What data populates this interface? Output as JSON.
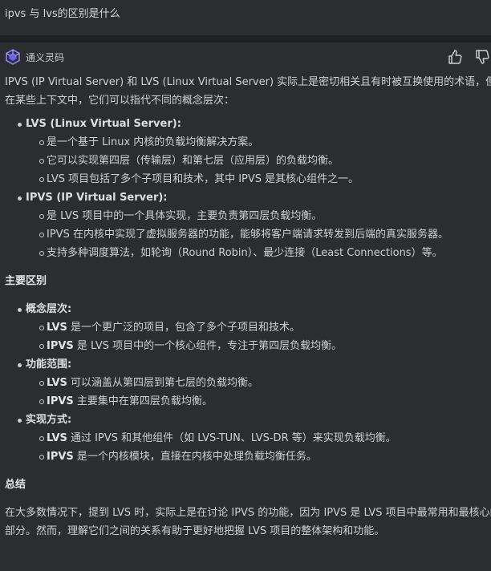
{
  "question": "ipvs 与 lvs的区别是什么",
  "assistant": {
    "name": "通义灵码",
    "logo_icon": "tongyi-logo-icon",
    "accent": "#7a6bff"
  },
  "actions": {
    "like_icon": "thumbs-up-icon",
    "dislike_icon": "thumbs-down-icon"
  },
  "answer": {
    "intro": "IPVS (IP Virtual Server) 和 LVS (Linux Virtual Server) 实际上是密切相关且有时被互换使用的术语，但在某些上下文中，它们可以指代不同的概念层次：",
    "lvs": {
      "title": "LVS (Linux Virtual Server):",
      "items": [
        "是一个基于 Linux 内核的负载均衡解决方案。",
        "它可以实现第四层（传输层）和第七层（应用层）的负载均衡。",
        "LVS 项目包括了多个子项目和技术，其中 IPVS 是其核心组件之一。"
      ]
    },
    "ipvs": {
      "title": "IPVS (IP Virtual Server):",
      "items": [
        "是 LVS 项目中的一个具体实现，主要负责第四层负载均衡。",
        "IPVS 在内核中实现了虚拟服务器的功能，能够将客户端请求转发到后端的真实服务器。",
        "支持多种调度算法，如轮询（Round Robin）、最少连接（Least Connections）等。"
      ]
    },
    "diff_heading": "主要区别",
    "diff": [
      {
        "title": "概念层次:",
        "items": [
          {
            "strong": "LVS",
            "text": " 是一个更广泛的项目，包含了多个子项目和技术。"
          },
          {
            "strong": "IPVS",
            "text": " 是 LVS 项目中的一个核心组件，专注于第四层负载均衡。"
          }
        ]
      },
      {
        "title": "功能范围:",
        "items": [
          {
            "strong": "LVS",
            "text": " 可以涵盖从第四层到第七层的负载均衡。"
          },
          {
            "strong": "IPVS",
            "text": " 主要集中在第四层负载均衡。"
          }
        ]
      },
      {
        "title": "实现方式:",
        "items": [
          {
            "strong": "LVS",
            "text": " 通过 IPVS 和其他组件（如 LVS-TUN、LVS-DR 等）来实现负载均衡。"
          },
          {
            "strong": "IPVS",
            "text": " 是一个内核模块，直接在内核中处理负载均衡任务。"
          }
        ]
      }
    ],
    "summary_heading": "总结",
    "summary": "在大多数情况下，提到 LVS 时，实际上是在讨论 IPVS 的功能，因为 IPVS 是 LVS 项目中最常用和最核心的部分。然而，理解它们之间的关系有助于更好地把握 LVS 项目的整体架构和功能。"
  }
}
